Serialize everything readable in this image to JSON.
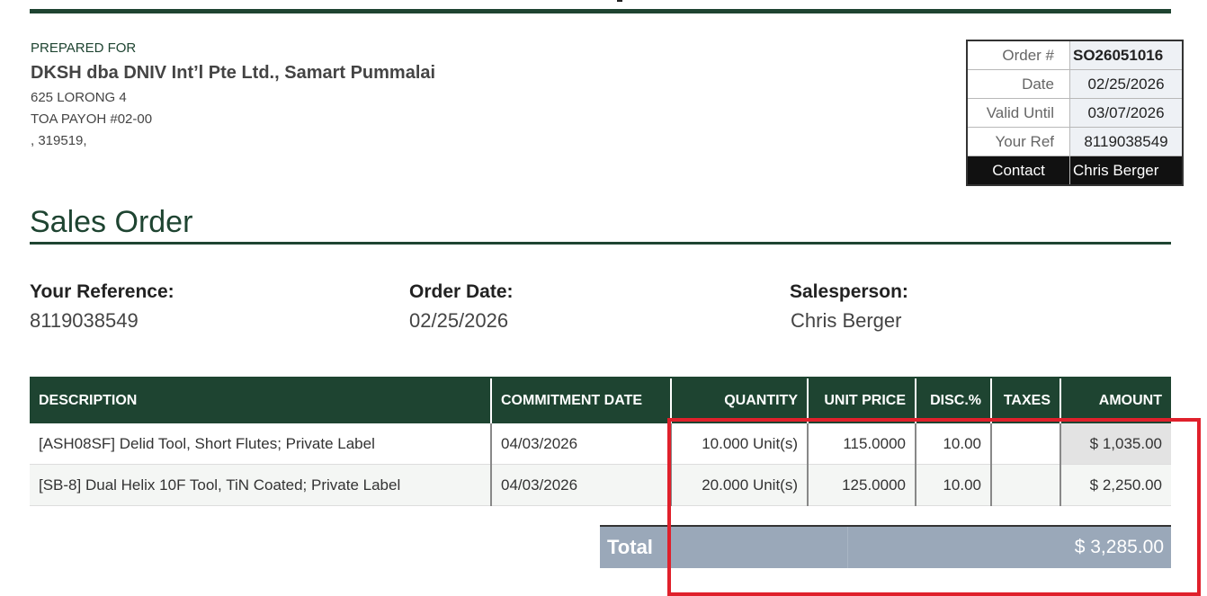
{
  "prepared_for": {
    "label": "PREPARED FOR",
    "name": "DKSH dba DNIV Int’l Pte Ltd., Samart Pummalai",
    "address_lines": [
      "625 LORONG 4",
      "TOA PAYOH #02-00",
      ", 319519,"
    ]
  },
  "info_box": [
    {
      "label": "Order #",
      "value": "SO26051016"
    },
    {
      "label": "Date",
      "value": "02/25/2026"
    },
    {
      "label": "Valid Until",
      "value": "03/07/2026"
    },
    {
      "label": "Your Ref",
      "value": "8119038549"
    },
    {
      "label": "Contact",
      "value": "Chris Berger"
    }
  ],
  "title": "Sales Order",
  "meta": {
    "reference_label": "Your Reference:",
    "reference_value": "8119038549",
    "date_label": "Order Date:",
    "date_value": "02/25/2026",
    "salesperson_label": "Salesperson:",
    "salesperson_value": "Chris Berger"
  },
  "table": {
    "headers": [
      "DESCRIPTION",
      "COMMITMENT DATE",
      "QUANTITY",
      "UNIT PRICE",
      "DISC.%",
      "TAXES",
      "AMOUNT"
    ],
    "rows": [
      [
        "[ASH08SF] Delid Tool, Short Flutes; Private Label",
        "04/03/2026",
        "10.000 Unit(s)",
        "115.0000",
        "10.00",
        "",
        "$ 1,035.00"
      ],
      [
        "[SB-8] Dual Helix 10F Tool, TiN Coated; Private Label",
        "04/03/2026",
        "20.000 Unit(s)",
        "125.0000",
        "10.00",
        "",
        "$ 2,250.00"
      ]
    ]
  },
  "total": {
    "label": "Total",
    "value": "$ 3,285.00"
  },
  "colors": {
    "brand_green": "#1e4431",
    "highlight_red": "#e0202b",
    "total_bg": "#9aa8b9"
  }
}
